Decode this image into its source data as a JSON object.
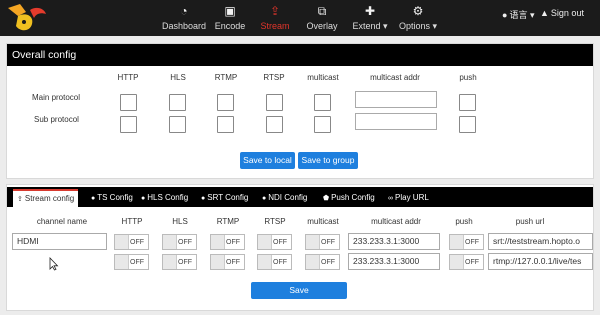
{
  "nav": {
    "items": [
      {
        "label": "Dashboard",
        "icon": "dashboard-icon"
      },
      {
        "label": "Encode",
        "icon": "image-icon"
      },
      {
        "label": "Stream",
        "icon": "upload-icon",
        "active": true
      },
      {
        "label": "Overlay",
        "icon": "overlay-icon"
      },
      {
        "label": "Extend",
        "icon": "puzzle-icon",
        "dropdown": true
      },
      {
        "label": "Options",
        "icon": "gears-icon",
        "dropdown": true
      }
    ],
    "language": "语言",
    "signout": "Sign out"
  },
  "overall": {
    "title": "Overall config",
    "columns": [
      "HTTP",
      "HLS",
      "RTMP",
      "RTSP",
      "multicast",
      "multicast addr",
      "push"
    ],
    "rows": [
      "Main protocol",
      "Sub protocol"
    ],
    "save_local": "Save to local",
    "save_group": "Save to group"
  },
  "stream": {
    "tabs": [
      "Stream config",
      "TS Config",
      "HLS Config",
      "SRT Config",
      "NDI Config",
      "Push Config",
      "Play URL"
    ],
    "columns": [
      "channel name",
      "HTTP",
      "HLS",
      "RTMP",
      "RTSP",
      "multicast",
      "multicast addr",
      "push",
      "push url"
    ],
    "toggle_off": "OFF",
    "rows": [
      {
        "channel": "HDMI",
        "multicast_addr": "233.233.3.1:3000",
        "push_url": "srt://teststream.hopto.o"
      },
      {
        "channel": "",
        "multicast_addr": "233.233.3.1:3000",
        "push_url": "rtmp://127.0.0.1/live/tes"
      }
    ],
    "save": "Save"
  },
  "colors": {
    "accent": "#1e7fde",
    "active_nav": "#e0352b",
    "header": "#000000"
  }
}
